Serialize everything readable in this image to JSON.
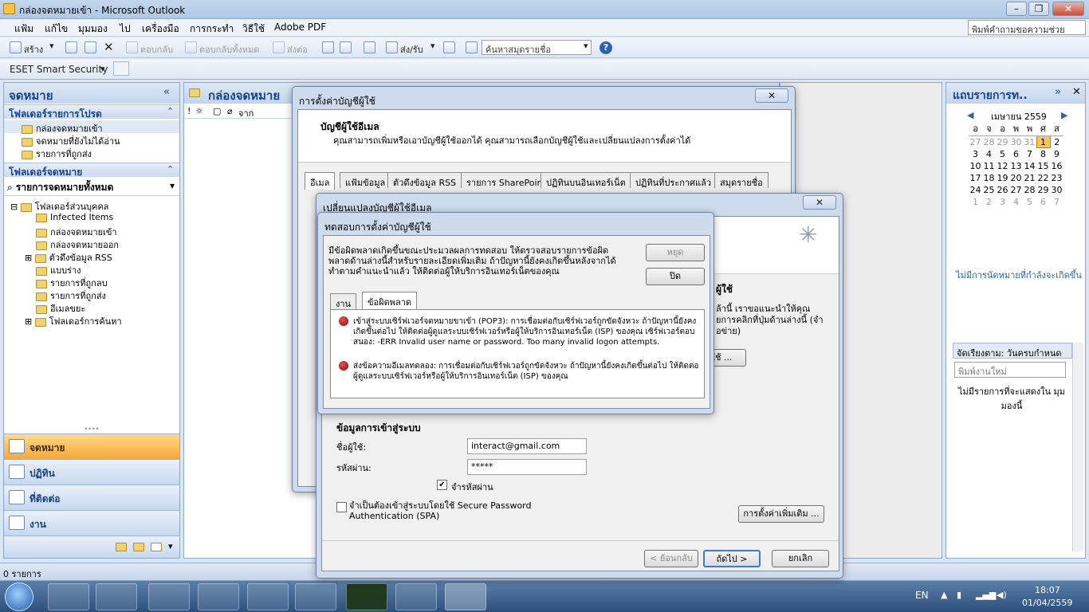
{
  "window": {
    "title": "กล่องจดหมายเข้า - Microsoft Outlook",
    "help_box": "พิมพ์คำถามขอความช่วยเหลือ"
  },
  "menu": [
    "แฟ้ม",
    "แก้ไข",
    "มุมมอง",
    "ไป",
    "เครื่องมือ",
    "การกระทำ",
    "วิธีใช้",
    "Adobe PDF"
  ],
  "toolbar": {
    "new": "สร้าง",
    "reply": "ตอบกลับ",
    "reply_all": "ตอบกลับทั้งหมด",
    "forward": "ส่งต่อ",
    "send_receive": "ส่ง/รับ",
    "search_contacts": "ค้นหาสมุดรายชื่อ",
    "eset": "ESET Smart Security"
  },
  "nav": {
    "title": "จดหมาย",
    "favorites_header": "โฟลเดอร์รายการโปรด",
    "favorites": [
      "กล่องจดหมายเข้า",
      "จดหมายที่ยังไม่ได้อ่าน",
      "รายการที่ถูกส่ง"
    ],
    "mail_folders_header": "โฟลเดอร์จดหมาย",
    "all_mail": "รายการจดหมายทั้งหมด",
    "personal": "โฟลเดอร์ส่วนบุคคล",
    "folders": [
      "Infected Items",
      "กล่องจดหมายเข้า",
      "กล่องจดหมายออก",
      "ตัวดึงข้อมูล RSS",
      "แบบร่าง",
      "รายการที่ถูกลบ",
      "รายการที่ถูกส่ง",
      "อีเมลขยะ",
      "โฟลเดอร์การค้นหา"
    ],
    "buttons": [
      "จดหมาย",
      "ปฏิทิน",
      "ที่ติดต่อ",
      "งาน"
    ]
  },
  "mid": {
    "title": "กล่องจดหมาย",
    "from_col": "จาก"
  },
  "tasks_pane": {
    "title": "แถบรายการท..",
    "month": "เมษายน 2559",
    "weekdays": [
      "อ",
      "จ",
      "อ",
      "พ",
      "พ",
      "ศ",
      "ส"
    ],
    "weeks": [
      [
        "27",
        "28",
        "29",
        "30",
        "31",
        "1",
        "2"
      ],
      [
        "3",
        "4",
        "5",
        "6",
        "7",
        "8",
        "9"
      ],
      [
        "10",
        "11",
        "12",
        "13",
        "14",
        "15",
        "16"
      ],
      [
        "17",
        "18",
        "19",
        "20",
        "21",
        "22",
        "23"
      ],
      [
        "24",
        "25",
        "26",
        "27",
        "28",
        "29",
        "30"
      ],
      [
        "1",
        "2",
        "3",
        "4",
        "5",
        "6",
        "7"
      ]
    ],
    "no_appointments": "ไม่มีการนัดหมายที่กำลังจะเกิดขึ้น",
    "sort_label": "จัดเรียงตาม: วันครบกำหนด",
    "new_task_placeholder": "พิมพ์งานใหม่",
    "no_items": "ไม่มีรายการที่จะแสดงใน มุมมองนี้"
  },
  "status": {
    "items": "0 รายการ"
  },
  "taskbar": {
    "lang": "EN",
    "time": "18:07",
    "date": "01/04/2559"
  },
  "acct_dialog": {
    "title": "การตั้งค่าบัญชีผู้ใช้",
    "heading": "บัญชีผู้ใช้อีเมล",
    "desc": "คุณสามารถเพิ่มหรือเอาบัญชีผู้ใช้ออกได้ คุณสามารถเลือกบัญชีผู้ใช้และเปลี่ยนแปลงการตั้งค่าได้",
    "tabs": [
      "อีเมล",
      "แฟ้มข้อมูล",
      "ตัวดึงข้อมูล RSS",
      "รายการ SharePoint",
      "ปฏิทินบนอินเทอร์เน็ต",
      "ปฏิทินที่ประกาศแล้ว",
      "สมุดรายชื่อ"
    ]
  },
  "change_dialog": {
    "title": "เปลี่ยนแปลงบัญชีผู้ใช้อีเมล",
    "partial_heading": "ผู้ใช้",
    "partial_text1": "ล้านี้ เราขอแนะนำให้คุณ",
    "partial_text2": "ยการคลิกที่ปุ่มด้านล่างนี้ (จำ",
    "partial_text3": "อข่าย)",
    "partial_btn": "ใช้ ...",
    "logon_header": "ข้อมูลการเข้าสู่ระบบ",
    "user_label": "ชื่อผู้ใช้:",
    "user_value": "interact@gmail.com",
    "pass_label": "รหัสผ่าน:",
    "pass_value": "*****",
    "remember": "จำรหัสผ่าน",
    "spa": "จำเป็นต้องเข้าสู่ระบบโดยใช้ Secure Password Authentication (SPA)",
    "more_settings": "การตั้งค่าเพิ่มเติม ...",
    "back": "< ย้อนกลับ",
    "next": "ถัดไป >",
    "cancel": "ยกเลิก"
  },
  "test_dialog": {
    "title": "ทดสอบการตั้งค่าบัญชีผู้ใช้",
    "message": "มีข้อผิดพลาดเกิดขึ้นขณะประมวลผลการทดสอบ ให้ตรวจสอบรายการข้อผิดพลาดด้านล่างนี้สำหรับรายละเอียดเพิ่มเติม ถ้าปัญหานี้ยังคงเกิดขึ้นหลังจากได้ทำตามคำแนะนำแล้ว ให้ติดต่อผู้ให้บริการอินเทอร์เน็ตของคุณ",
    "stop": "หยุด",
    "close": "ปิด",
    "tabs": [
      "งาน",
      "ข้อผิดพลาด"
    ],
    "error1": "เข้าสู่ระบบเซิร์ฟเวอร์จดหมายขาเข้า (POP3): การเชื่อมต่อกับเซิร์ฟเวอร์ถูกขัดจังหวะ ถ้าปัญหานี้ยังคงเกิดขึ้นต่อไป ให้ติดต่อผู้ดูแลระบบเซิร์ฟเวอร์หรือผู้ให้บริการอินเทอร์เน็ต (ISP) ของคุณ เซิร์ฟเวอร์ตอบสนอง:  -ERR Invalid user name or password. Too many invalid logon attempts.",
    "error2": "ส่งข้อความอีเมลทดลอง: การเชื่อมต่อกับเซิร์ฟเวอร์ถูกขัดจังหวะ ถ้าปัญหานี้ยังคงเกิดขึ้นต่อไป ให้ติดต่อผู้ดูแลระบบเซิร์ฟเวอร์หรือผู้ให้บริการอินเทอร์เน็ต (ISP) ของคุณ"
  }
}
